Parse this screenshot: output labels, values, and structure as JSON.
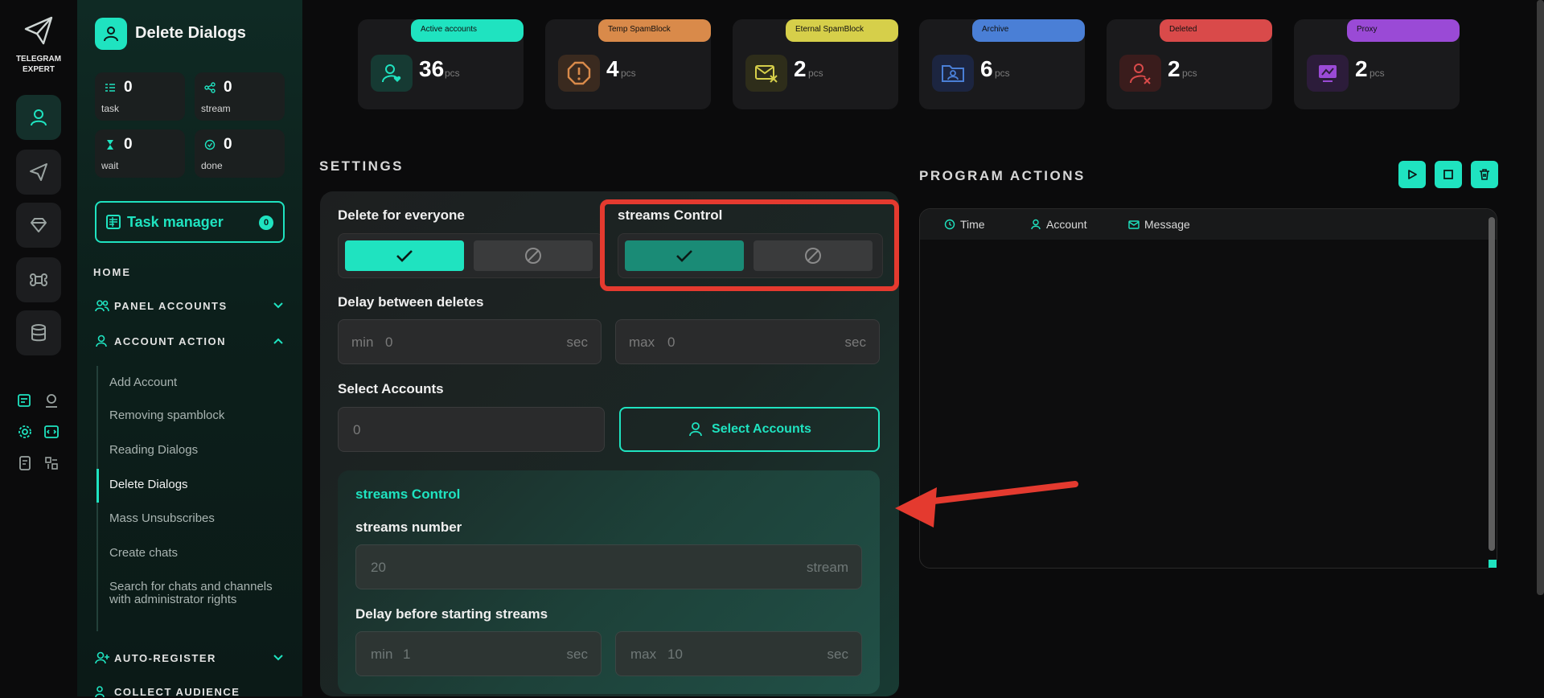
{
  "brand": {
    "line1": "TELEGRAM",
    "line2": "EXPERT"
  },
  "sidebar": {
    "title": "Delete Dialogs",
    "stats": [
      {
        "value": "0",
        "label": "task"
      },
      {
        "value": "0",
        "label": "stream"
      },
      {
        "value": "0",
        "label": "wait"
      },
      {
        "value": "0",
        "label": "done"
      }
    ],
    "task_manager": {
      "label": "Task manager",
      "count": "0"
    },
    "home": "HOME",
    "groups": {
      "panel_accounts": "PANEL ACCOUNTS",
      "account_action": "ACCOUNT ACTION",
      "auto_register": "AUTO-REGISTER",
      "collect_audience": "COLLECT AUDIENCE"
    },
    "items": [
      "Add Account",
      "Removing spamblock",
      "Reading Dialogs",
      "Delete Dialogs",
      "Mass Unsubscribes",
      "Create chats",
      "Search for chats and channels with administrator rights"
    ]
  },
  "cards": [
    {
      "tag": "Active accounts",
      "value": "36",
      "unit": "pcs",
      "color": "#1fe3c0"
    },
    {
      "tag": "Temp SpamBlock",
      "value": "4",
      "unit": "pcs",
      "color": "#d98a4a"
    },
    {
      "tag": "Eternal SpamBlock",
      "value": "2",
      "unit": "pcs",
      "color": "#d6cf4a"
    },
    {
      "tag": "Archive",
      "value": "6",
      "unit": "pcs",
      "color": "#4a7fd6"
    },
    {
      "tag": "Deleted",
      "value": "2",
      "unit": "pcs",
      "color": "#d94a4a"
    },
    {
      "tag": "Proxy",
      "value": "2",
      "unit": "pcs",
      "color": "#9a4ad6"
    }
  ],
  "settings": {
    "heading": "SETTINGS",
    "delete_for_everyone": "Delete for everyone",
    "streams_control": "streams Control",
    "delay_between_deletes": "Delay between deletes",
    "min_label": "min",
    "max_label": "max",
    "sec": "sec",
    "delay_min": "0",
    "delay_max": "0",
    "select_accounts": "Select Accounts",
    "select_accounts_value": "0",
    "select_accounts_button": "Select Accounts",
    "sub": {
      "title": "streams Control",
      "streams_number": "streams number",
      "streams_placeholder": "20",
      "stream_unit": "stream",
      "delay_before": "Delay before starting streams",
      "min_value": "1",
      "max_value": "10"
    }
  },
  "program_actions": {
    "heading": "PROGRAM ACTIONS",
    "columns": [
      "Time",
      "Account",
      "Message"
    ]
  },
  "colors": {
    "accent": "#1fe3c0",
    "highlight": "#e43a2f"
  }
}
